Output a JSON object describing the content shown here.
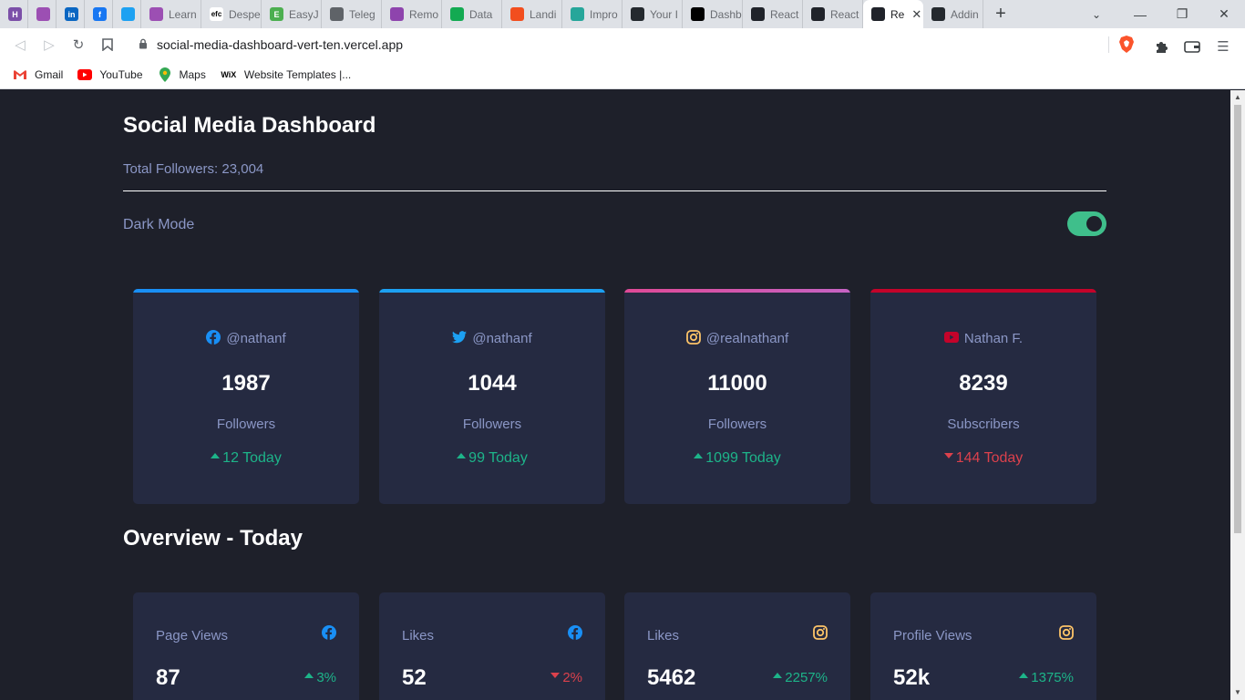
{
  "browser": {
    "tabs": [
      {
        "label": "",
        "icon": "h-icon",
        "color": "#7b4fa8",
        "glyph": "H"
      },
      {
        "label": "",
        "icon": "avatar-icon",
        "color": "#9c4fb3",
        "glyph": ""
      },
      {
        "label": "",
        "icon": "linkedin-icon",
        "color": "#0a66c2",
        "glyph": "in"
      },
      {
        "label": "",
        "icon": "facebook-icon",
        "color": "#1877f2",
        "glyph": "f"
      },
      {
        "label": "",
        "icon": "twitter-icon",
        "color": "#1da1f2",
        "glyph": ""
      },
      {
        "label": "Learn",
        "icon": "avatar-icon",
        "color": "#9c4fb3",
        "glyph": ""
      },
      {
        "label": "Despe",
        "icon": "efc-icon",
        "color": "#ffffff",
        "glyph": "efc"
      },
      {
        "label": "EasyJ",
        "icon": "easyjet-icon",
        "color": "#4caf50",
        "glyph": "E"
      },
      {
        "label": "Teleg",
        "icon": "globe-icon",
        "color": "#5f6368",
        "glyph": ""
      },
      {
        "label": "Remo",
        "icon": "remo-icon",
        "color": "#8e44ad",
        "glyph": ""
      },
      {
        "label": "Data",
        "icon": "leaf-icon",
        "color": "#13aa52",
        "glyph": ""
      },
      {
        "label": "Landi",
        "icon": "figma-icon",
        "color": "#f24e1e",
        "glyph": ""
      },
      {
        "label": "Impro",
        "icon": "eye-icon",
        "color": "#26a69a",
        "glyph": ""
      },
      {
        "label": "Your I",
        "icon": "github-icon",
        "color": "#24292e",
        "glyph": ""
      },
      {
        "label": "Dashb",
        "icon": "vercel-icon",
        "color": "#000000",
        "glyph": ""
      },
      {
        "label": "React",
        "icon": "react-icon",
        "color": "#20232a",
        "glyph": ""
      },
      {
        "label": "React",
        "icon": "react-icon",
        "color": "#20232a",
        "glyph": ""
      },
      {
        "label": "Re",
        "icon": "react-icon",
        "color": "#20232a",
        "glyph": "",
        "active": true
      },
      {
        "label": "Addin",
        "icon": "github-icon",
        "color": "#24292e",
        "glyph": ""
      }
    ],
    "url": "social-media-dashboard-vert-ten.vercel.app",
    "bookmarks": [
      {
        "label": "Gmail",
        "icon": "gmail-icon"
      },
      {
        "label": "YouTube",
        "icon": "youtube-icon"
      },
      {
        "label": "Maps",
        "icon": "maps-icon"
      },
      {
        "label": "Website Templates |...",
        "icon": "wix-icon"
      }
    ]
  },
  "dashboard": {
    "title": "Social Media Dashboard",
    "total_followers": "Total Followers: 23,004",
    "dark_mode_label": "Dark Mode",
    "dark_mode_on": true,
    "cards": [
      {
        "platform": "facebook",
        "handle": "@nathanf",
        "count": "1987",
        "label": "Followers",
        "today": "12 Today",
        "trend": "up",
        "accent": "#198ff5"
      },
      {
        "platform": "twitter",
        "handle": "@nathanf",
        "count": "1044",
        "label": "Followers",
        "today": "99 Today",
        "trend": "up",
        "accent": "#1ca0f2"
      },
      {
        "platform": "instagram",
        "handle": "@realnathanf",
        "count": "11000",
        "label": "Followers",
        "today": "1099 Today",
        "trend": "up",
        "accent": "#de4f9b"
      },
      {
        "platform": "youtube",
        "handle": "Nathan F.",
        "count": "8239",
        "label": "Subscribers",
        "today": "144 Today",
        "trend": "down",
        "accent": "#c4032a"
      }
    ],
    "overview_title": "Overview - Today",
    "overview": [
      {
        "label": "Page Views",
        "platform": "facebook",
        "value": "87",
        "pct": "3%",
        "trend": "up"
      },
      {
        "label": "Likes",
        "platform": "facebook",
        "value": "52",
        "pct": "2%",
        "trend": "down"
      },
      {
        "label": "Likes",
        "platform": "instagram",
        "value": "5462",
        "pct": "2257%",
        "trend": "up"
      },
      {
        "label": "Profile Views",
        "platform": "instagram",
        "value": "52k",
        "pct": "1375%",
        "trend": "up"
      }
    ]
  }
}
